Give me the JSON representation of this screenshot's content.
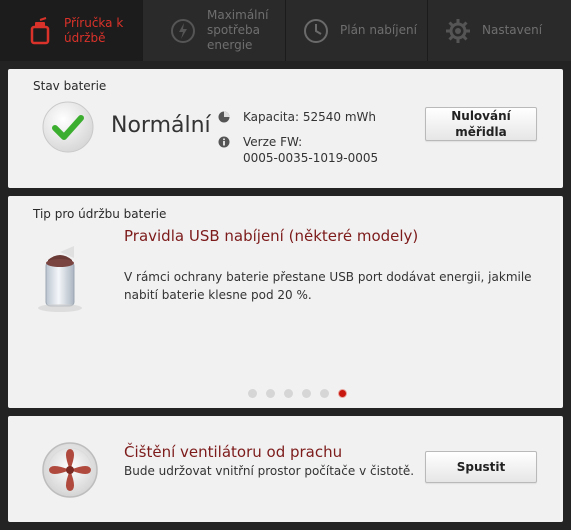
{
  "tabs": [
    {
      "label_line1": "Příručka k",
      "label_line2": "údržbě",
      "icon": "battery-care-icon",
      "active": true
    },
    {
      "label_line1": "Maximální",
      "label_line2": "spotřeba",
      "label_line3": "energie",
      "icon": "power-icon",
      "active": false
    },
    {
      "label": "Plán nabíjení",
      "icon": "clock-icon",
      "active": false
    },
    {
      "label": "Nastavení",
      "icon": "gear-icon",
      "active": false
    }
  ],
  "battery_status": {
    "title": "Stav baterie",
    "status_icon": "check-icon",
    "status": "Normální",
    "capacity": "Kapacita: 52540 mWh",
    "fw_label": "Verze FW:",
    "fw_value": "0005-0035-1019-0005",
    "reset_button_line1": "Nulování",
    "reset_button_line2": "měřidla"
  },
  "tip": {
    "title": "Tip pro údržbu baterie",
    "heading": "Pravidla USB nabíjení (některé modely)",
    "body": "V rámci ochrany baterie přestane USB port dodávat energii, jakmile nabití baterie klesne pod 20 %.",
    "dots_total": 6,
    "active_dot": 5
  },
  "fan": {
    "heading": "Čištění ventilátoru od prachu",
    "body": "Bude udržovat vnitřní prostor počítače v čistotě.",
    "button": "Spustit"
  },
  "colors": {
    "accent": "#d9322a",
    "heading": "#7d1b1b",
    "check": "#3cae2f"
  }
}
